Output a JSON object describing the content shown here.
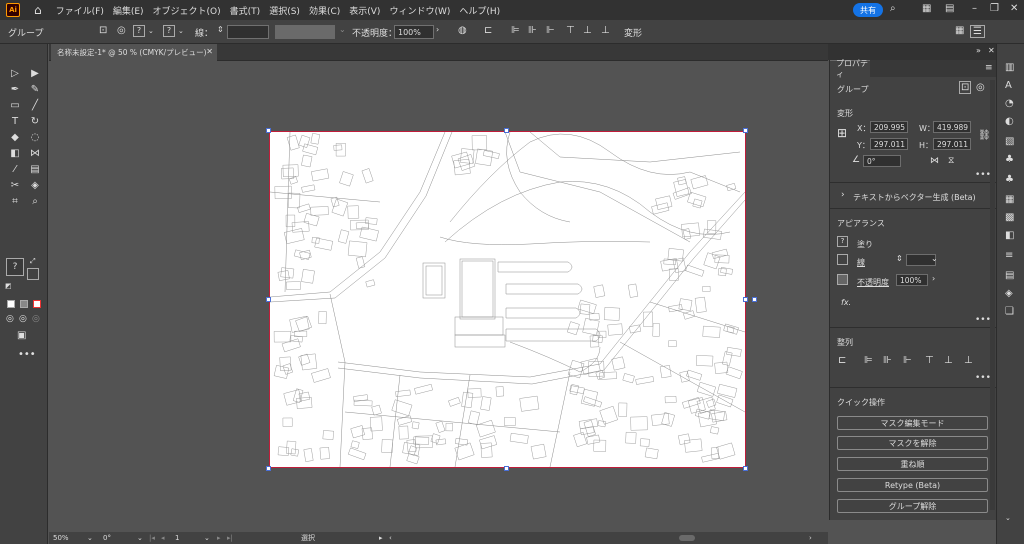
{
  "menubar": {
    "logo": "Ai",
    "menus": [
      "ファイル(F)",
      "編集(E)",
      "オブジェクト(O)",
      "書式(T)",
      "選択(S)",
      "効果(C)",
      "表示(V)",
      "ウィンドウ(W)",
      "ヘルプ(H)"
    ],
    "share_label": "共有"
  },
  "controlbar": {
    "selection_label": "グループ",
    "stroke_label": "線：",
    "opacity_label": "不透明度：",
    "opacity_value": "100%",
    "transform_label": "変形"
  },
  "document_tab": {
    "title": "名称未設定-1* @ 50 % (CMYK/プレビュー)"
  },
  "statusbar": {
    "zoom": "50%",
    "rotation": "0°",
    "artboard_number": "1",
    "tool_name": "選択"
  },
  "properties_panel": {
    "tab_label": "プロパティ",
    "object_type": "グループ",
    "transform_header": "変形",
    "x_label": "X：",
    "x_value": "209.995",
    "w_label": "W：",
    "w_value": "419.989",
    "y_label": "Y：",
    "y_value": "297.011",
    "h_label": "H：",
    "h_value": "297.011",
    "angle_value": "0°",
    "vector_gen_label": "テキストからベクター生成 (Beta)",
    "appearance_header": "アピアランス",
    "fill_label": "塗り",
    "stroke_label": "線",
    "opacity_label": "不透明度",
    "opacity_value": "100%",
    "fx_label": "fx.",
    "align_header": "整列",
    "quick_actions_header": "クイック操作",
    "quick_actions": [
      "マスク編集モード",
      "マスクを解除",
      "重ね順",
      "Retype (Beta)",
      "グループ解除"
    ]
  },
  "colors": {
    "artboard_border": "#c01d3a",
    "selection_handle": "#4a6fd6",
    "share_button": "#1473e6",
    "logo_accent": "#ff9a00"
  }
}
